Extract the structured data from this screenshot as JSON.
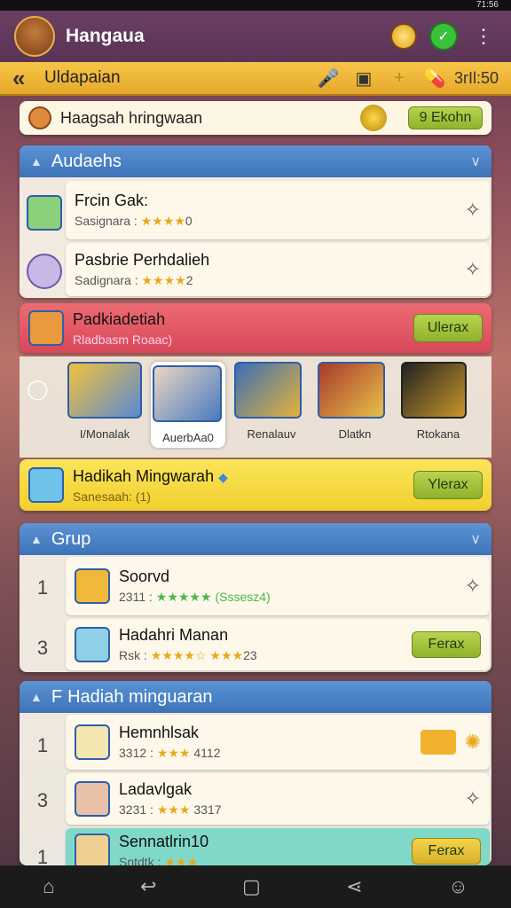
{
  "status_right": "71:56",
  "app": {
    "title": "Hangaua"
  },
  "nav": {
    "back_icon": "chevron-left",
    "title": "Uldapaian",
    "time": "3rIl:50"
  },
  "promo": {
    "text": "Haagsah hringwaan",
    "button": "9 Ekohn"
  },
  "section1": {
    "title": "Audaehs",
    "items": [
      {
        "title": "Frcin Gak:",
        "subtitle": "Sasignara :",
        "stars": "★★★★",
        "score": "0"
      },
      {
        "title": "Pasbrie Perhdalieh",
        "subtitle": "Sadignara :",
        "stars": "★★★★",
        "score": "2"
      }
    ]
  },
  "highlight_red": {
    "title": "Padkiadetiah",
    "subtitle": "Rladbasm Roaac)",
    "button": "Ulerax"
  },
  "tray": {
    "tiles": [
      "I/Monalak",
      "AuerbAa0",
      "Renalauv",
      "Dlatkn",
      "Rtokana"
    ]
  },
  "highlight_yellow": {
    "title": "Hadikah Mingwarah",
    "subtitle": "Sanesaah: (1)",
    "button": "Ylerax"
  },
  "section2": {
    "title": "Grup",
    "rows": [
      {
        "rank": "1",
        "title": "Soorvd",
        "subtitle": "2311 :",
        "stars": "★★★★★",
        "extra": "(Sssesz4)"
      },
      {
        "rank": "3",
        "title": "Hadahri Manan",
        "subtitle": "Rsk :",
        "stars": "★★★★☆ ★★★",
        "extra": "23",
        "button": "Ferax"
      }
    ]
  },
  "section3": {
    "title": "Hadiah minguaran",
    "title_prefix": "F",
    "rows": [
      {
        "rank": "1",
        "title": "Hemnhlsak",
        "subtitle": "3312 :",
        "stars": "★★★",
        "extra": "4112"
      },
      {
        "rank": "3",
        "title": "Ladavlgak",
        "subtitle": "3231 :",
        "stars": "★★★",
        "extra": "3317"
      },
      {
        "rank": "1",
        "title": "Sennatlrin10",
        "subtitle": "Sntdtk :",
        "stars": "★★★",
        "extra": "",
        "button": "Ferax"
      }
    ]
  },
  "colors": {
    "accent_yellow": "#f7c548",
    "header_blue": "#3d73b8",
    "highlight_red": "#e0505c",
    "button_green": "#9fc23a"
  },
  "bottom_nav": [
    "home-icon",
    "back-icon",
    "square-icon",
    "share-icon",
    "profile-icon"
  ]
}
